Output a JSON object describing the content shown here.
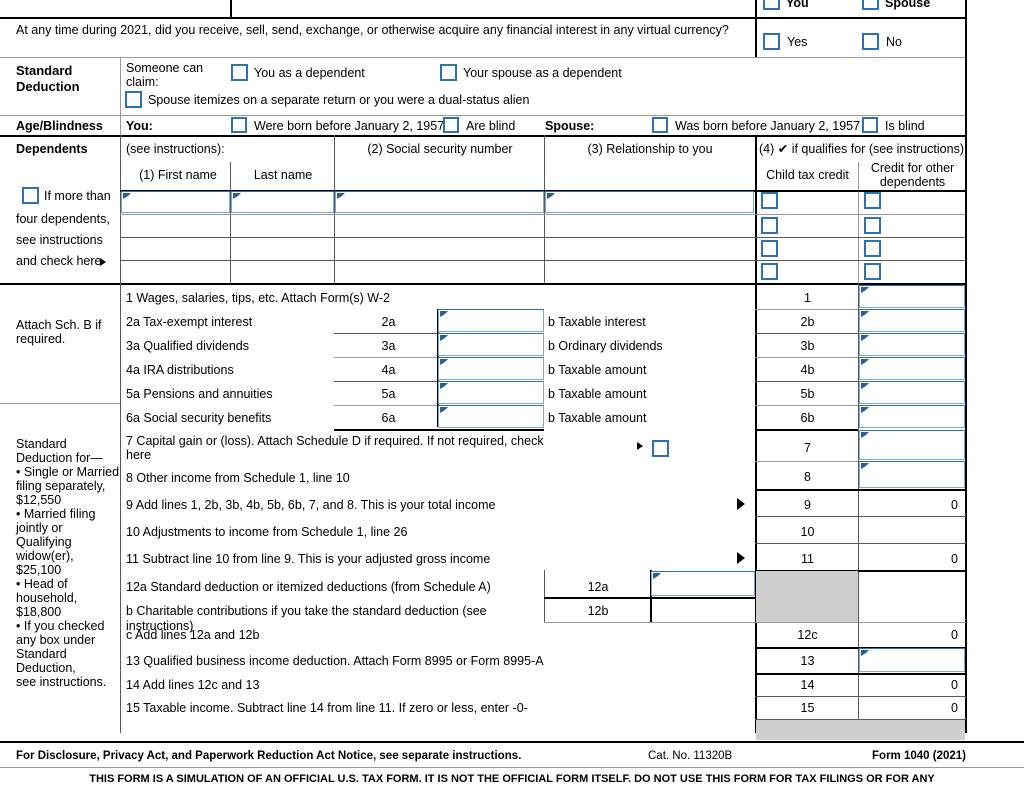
{
  "colors": {
    "checkbox_blue": "#2f6fb5",
    "field_border": "#7fa7d4",
    "shade_gray": "#cfcfcf",
    "rule_black": "#000000"
  },
  "virtual_currency": {
    "top_you_label": "You",
    "top_spouse_label": "Spouse",
    "question": "At any time during 2021, did you receive, sell, send, exchange, or otherwise acquire any financial interest in any virtual currency?",
    "yes_label": "Yes",
    "no_label": "No"
  },
  "standard_deduction": {
    "section_label_line1": "Standard",
    "section_label_line2": "Deduction",
    "someone_can_claim_line1": "Someone can",
    "someone_can_claim_line2": "claim:",
    "you_as_dependent": "You as a dependent",
    "spouse_as_dependent": "Your spouse as a dependent",
    "spouse_itemizes": "Spouse itemizes on a separate return or you were a dual-status alien"
  },
  "age_blindness": {
    "section_label": "Age/Blindness",
    "you_label": "You:",
    "you_born_before": "Were born before January 2, 1957",
    "you_blind": "Are blind",
    "spouse_label": "Spouse:",
    "spouse_born_before": "Was born before January 2, 1957",
    "spouse_blind": "Is blind"
  },
  "dependents": {
    "section_label": "Dependents",
    "see_instructions": "(see instructions):",
    "more_than_four": [
      "If more than",
      "four dependents,",
      "see instructions",
      "and check here"
    ],
    "col_first_name": "(1) First name",
    "col_last_name": "Last name",
    "col_ssn": "(2) Social security number",
    "col_relationship": "(3) Relationship to you",
    "col_qualifies": "(4) ✔ if qualifies for (see instructions):",
    "col_child_tax_credit": "Child tax credit",
    "col_credit_other_line1": "Credit for other",
    "col_credit_other_line2": "dependents",
    "rows": [
      {
        "first_name": "",
        "last_name": "",
        "ssn": "",
        "relationship": "",
        "ctc": false,
        "cod": false
      },
      {
        "first_name": "",
        "last_name": "",
        "ssn": "",
        "relationship": "",
        "ctc": false,
        "cod": false
      },
      {
        "first_name": "",
        "last_name": "",
        "ssn": "",
        "relationship": "",
        "ctc": false,
        "cod": false
      },
      {
        "first_name": "",
        "last_name": "",
        "ssn": "",
        "relationship": "",
        "ctc": false,
        "cod": false
      }
    ]
  },
  "income": {
    "attach_sch_b_line1": "Attach Sch. B if",
    "attach_sch_b_line2": "required.",
    "line1": "1 Wages, salaries, tips, etc. Attach Form(s) W-2",
    "line1_no": "1",
    "line1_amount": "",
    "line2a": "2a Tax-exempt interest",
    "line2a_no": "2a",
    "line2a_amount": "",
    "line2b": "b Taxable interest",
    "line2b_no": "2b",
    "line2b_amount": "",
    "line3a": "3a Qualified dividends",
    "line3a_no": "3a",
    "line3a_amount": "",
    "line3b": "b Ordinary dividends",
    "line3b_no": "3b",
    "line3b_amount": "",
    "line4a": "4a IRA distributions",
    "line4a_no": "4a",
    "line4a_amount": "",
    "line4b": "b Taxable amount",
    "line4b_no": "4b",
    "line4b_amount": "",
    "line5a": "5a Pensions and annuities",
    "line5a_no": "5a",
    "line5a_amount": "",
    "line5b": "b Taxable amount",
    "line5b_no": "5b",
    "line5b_amount": "",
    "line6a": "6a Social security benefits",
    "line6a_no": "6a",
    "line6a_amount": "",
    "line6b": "b Taxable amount",
    "line6b_no": "6b",
    "line6b_amount": "",
    "line7_part1": "7 Capital gain or (loss). Attach Schedule D if required. If not required, check",
    "line7_part2": "here",
    "line7_no": "7",
    "line7_amount": "",
    "line8": "8 Other income from Schedule 1, line 10",
    "line8_no": "8",
    "line8_amount": "",
    "line9": "9 Add lines 1, 2b, 3b, 4b, 5b, 6b, 7, and 8. This is your total income",
    "line9_no": "9",
    "line9_amount": "0",
    "line10": "10 Adjustments to income from Schedule 1, line 26",
    "line10_no": "10",
    "line10_amount": "",
    "line11": "11 Subtract line 10 from line 9. This is your adjusted gross income",
    "line11_no": "11",
    "line11_amount": "0"
  },
  "deduction_sidebar": [
    "Standard",
    "Deduction for—",
    "• Single or Married",
    "filing separately,",
    "$12,550",
    "• Married filing",
    "jointly or",
    "Qualifying",
    "widow(er),",
    "$25,100",
    "• Head of",
    "household,",
    "$18,800",
    "• If you checked",
    "any box under",
    "Standard",
    "Deduction,",
    "see instructions."
  ],
  "deductions": {
    "line12a": "12a Standard deduction or itemized deductions (from Schedule A)",
    "line12a_no": "12a",
    "line12a_amount": "",
    "line12b": "b Charitable contributions if you take the standard deduction (see instructions)",
    "line12b_no": "12b",
    "line12b_amount": "",
    "line12c": "c Add lines 12a and 12b",
    "line12c_no": "12c",
    "line12c_amount": "0",
    "line13": "13 Qualified business income deduction. Attach Form 8995 or Form 8995-A",
    "line13_no": "13",
    "line13_amount": "",
    "line14": "14 Add lines 12c and 13",
    "line14_no": "14",
    "line14_amount": "0",
    "line15": "15 Taxable income. Subtract line 14 from line 11. If zero or less, enter -0-",
    "line15_no": "15",
    "line15_amount": "0"
  },
  "footer": {
    "disclosure": "For Disclosure, Privacy Act, and Paperwork Reduction Act Notice, see separate instructions.",
    "cat_no": "Cat. No. 11320B",
    "form_id": "Form 1040 (2021)",
    "disclaimer": "THIS FORM IS A SIMULATION OF AN OFFICIAL U.S. TAX FORM. IT IS NOT THE OFFICIAL FORM ITSELF. DO NOT USE THIS FORM FOR TAX FILINGS OR FOR ANY"
  }
}
